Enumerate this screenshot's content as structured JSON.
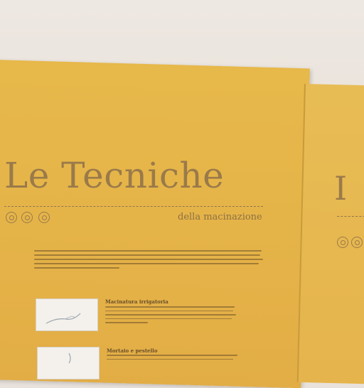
{
  "panel": {
    "title": "Le Tecniche",
    "subtitle": "della macinazione",
    "second_panel_letter": "I"
  },
  "entries": [
    {
      "heading": "Macinatura irrigatoria"
    },
    {
      "heading": "Mortaio e pestello"
    }
  ],
  "colors": {
    "panel_bg": "#e5b449",
    "title_text": "#9a7a4a",
    "wall": "#e9e2dc"
  }
}
